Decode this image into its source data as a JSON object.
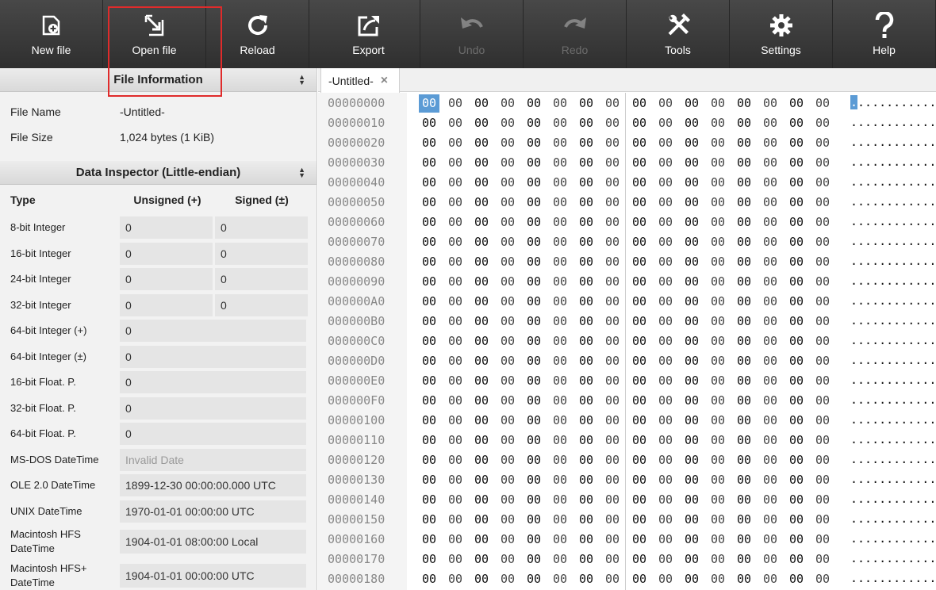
{
  "toolbar": {
    "buttons": [
      {
        "label": "New file",
        "icon": "new-file-icon",
        "disabled": false
      },
      {
        "label": "Open file",
        "icon": "open-file-icon",
        "disabled": false
      },
      {
        "label": "Reload",
        "icon": "reload-icon",
        "disabled": false
      },
      {
        "label": "Export",
        "icon": "export-icon",
        "disabled": false
      },
      {
        "label": "Undo",
        "icon": "undo-icon",
        "disabled": true
      },
      {
        "label": "Redo",
        "icon": "redo-icon",
        "disabled": true
      },
      {
        "label": "Tools",
        "icon": "tools-icon",
        "disabled": false
      },
      {
        "label": "Settings",
        "icon": "gear-icon",
        "disabled": false
      },
      {
        "label": "Help",
        "icon": "help-icon",
        "disabled": false
      }
    ]
  },
  "file_info": {
    "title": "File Information",
    "name_label": "File Name",
    "name_value": "-Untitled-",
    "size_label": "File Size",
    "size_value": "1,024 bytes (1 KiB)"
  },
  "inspector": {
    "title": "Data Inspector (Little-endian)",
    "col_type": "Type",
    "col_unsigned": "Unsigned (+)",
    "col_signed": "Signed (±)",
    "rows": [
      {
        "type": "8-bit Integer",
        "unsigned": "0",
        "signed": "0"
      },
      {
        "type": "16-bit Integer",
        "unsigned": "0",
        "signed": "0"
      },
      {
        "type": "24-bit Integer",
        "unsigned": "0",
        "signed": "0"
      },
      {
        "type": "32-bit Integer",
        "unsigned": "0",
        "signed": "0"
      },
      {
        "type": "64-bit Integer (+)",
        "value": "0"
      },
      {
        "type": "64-bit Integer (±)",
        "value": "0"
      },
      {
        "type": "16-bit Float. P.",
        "value": "0"
      },
      {
        "type": "32-bit Float. P.",
        "value": "0"
      },
      {
        "type": "64-bit Float. P.",
        "value": "0"
      },
      {
        "type": "MS-DOS DateTime",
        "value": "Invalid Date",
        "muted": true
      },
      {
        "type": "OLE 2.0 DateTime",
        "value": "1899-12-30 00:00:00.000 UTC"
      },
      {
        "type": "UNIX DateTime",
        "value": "1970-01-01 00:00:00 UTC"
      },
      {
        "type": "Macintosh HFS DateTime",
        "value": "1904-01-01 08:00:00 Local",
        "tall": true
      },
      {
        "type": "Macintosh HFS+ DateTime",
        "value": "1904-01-01 00:00:00 UTC",
        "tall": true
      }
    ]
  },
  "editor": {
    "tab_label": "-Untitled-",
    "offsets": [
      "00000000",
      "00000010",
      "00000020",
      "00000030",
      "00000040",
      "00000050",
      "00000060",
      "00000070",
      "00000080",
      "00000090",
      "000000A0",
      "000000B0",
      "000000C0",
      "000000D0",
      "000000E0",
      "000000F0",
      "00000100",
      "00000110",
      "00000120",
      "00000130",
      "00000140",
      "00000150",
      "00000160",
      "00000170",
      "00000180"
    ],
    "byte_value": "00",
    "ascii_row": "................",
    "selected_offset": "00000000"
  },
  "colors": {
    "toolbar_bg": "#3a3a3a",
    "selection": "#5b9bd5",
    "highlight_box": "#e02b2b"
  }
}
